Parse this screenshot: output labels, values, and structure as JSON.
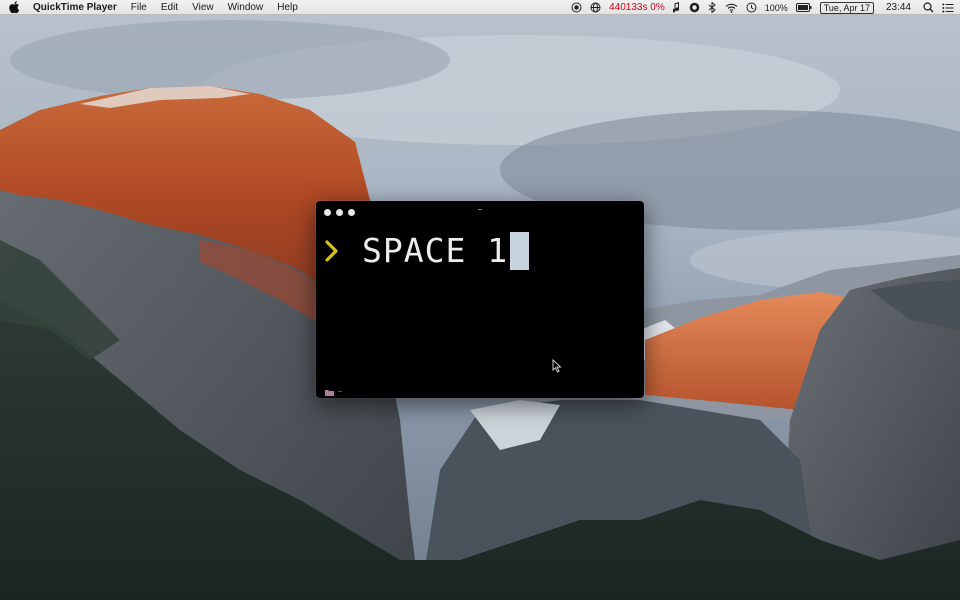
{
  "menubar": {
    "apple_icon": "apple-logo-icon",
    "app_name": "QuickTime Player",
    "menus": [
      "File",
      "Edit",
      "View",
      "Window",
      "Help"
    ],
    "status": {
      "record_icon": "record-icon",
      "globe_icon": "globe-icon",
      "counter": "440133s 0%",
      "music_icon": "music-note-icon",
      "skype_icon": "skype-icon",
      "bluetooth_icon": "bluetooth-icon",
      "wifi_icon": "wifi-icon",
      "time_machine_icon": "time-machine-icon",
      "battery_percent": "100%",
      "battery_icon": "battery-icon",
      "date": "Tue, Apr 17",
      "time": "23:44",
      "spotlight_icon": "search-icon",
      "notification_icon": "notification-list-icon"
    }
  },
  "terminal": {
    "title": "~",
    "prompt_symbol": "❯",
    "prompt_color": "#d4c214",
    "command": "SPACE 1",
    "status_path": "~",
    "cursor_color": "#c8d3e0"
  }
}
